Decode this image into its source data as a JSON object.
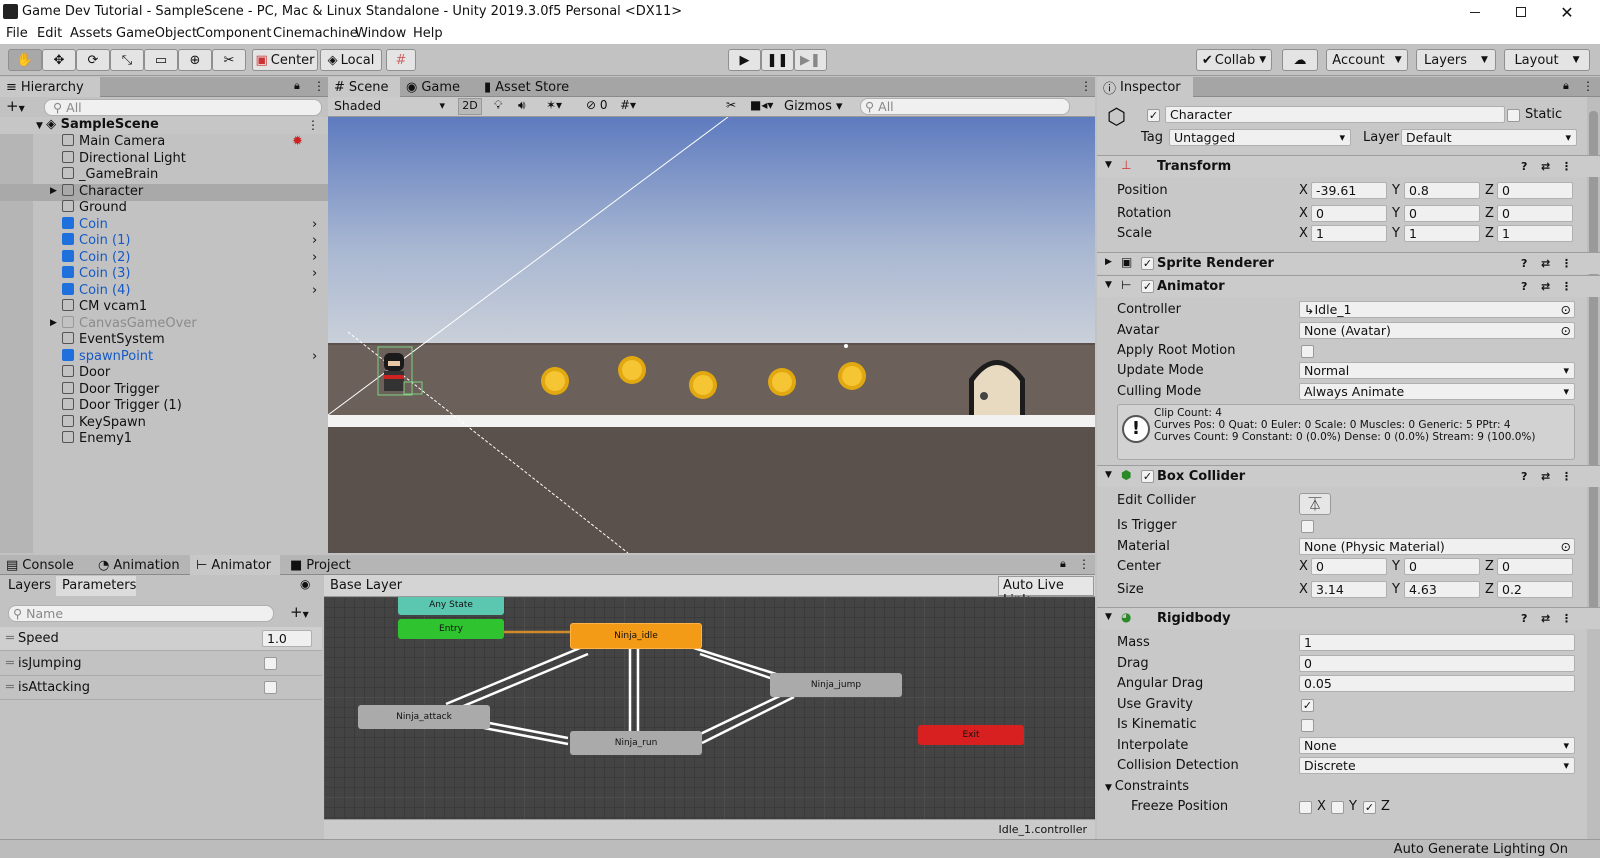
{
  "window": {
    "title": "Game Dev Tutorial - SampleScene - PC, Mac & Linux Standalone - Unity 2019.3.0f5 Personal <DX11>"
  },
  "menu": [
    "File",
    "Edit",
    "Assets",
    "GameObject",
    "Component",
    "Cinemachine",
    "Window",
    "Help"
  ],
  "toolbar": {
    "pivot": "Center",
    "space": "Local",
    "collab": "Collab",
    "account": "Account",
    "layers": "Layers",
    "layout": "Layout"
  },
  "hierarchy": {
    "tab": "Hierarchy",
    "search_placeholder": "All",
    "scene": "SampleScene",
    "items": [
      {
        "name": "Main Camera",
        "style": "normal"
      },
      {
        "name": "Directional Light",
        "style": "normal"
      },
      {
        "name": "_GameBrain",
        "style": "normal"
      },
      {
        "name": "Character",
        "style": "selected"
      },
      {
        "name": "Ground",
        "style": "normal"
      },
      {
        "name": "Coin",
        "style": "prefab"
      },
      {
        "name": "Coin (1)",
        "style": "prefab"
      },
      {
        "name": "Coin (2)",
        "style": "prefab"
      },
      {
        "name": "Coin (3)",
        "style": "prefab"
      },
      {
        "name": "Coin (4)",
        "style": "prefab"
      },
      {
        "name": "CM vcam1",
        "style": "normal"
      },
      {
        "name": "CanvasGameOver",
        "style": "disabled"
      },
      {
        "name": "EventSystem",
        "style": "normal"
      },
      {
        "name": "spawnPoint",
        "style": "prefab"
      },
      {
        "name": "Door",
        "style": "normal"
      },
      {
        "name": "Door Trigger",
        "style": "normal"
      },
      {
        "name": "Door Trigger (1)",
        "style": "normal"
      },
      {
        "name": "KeySpawn",
        "style": "normal"
      },
      {
        "name": "Enemy1",
        "style": "normal"
      }
    ]
  },
  "scene": {
    "tabs": [
      "Scene",
      "Game",
      "Asset Store"
    ],
    "shading": "Shaded",
    "mode2d": "2D",
    "hidden_count": "0",
    "gizmos": "Gizmos",
    "search_placeholder": "All"
  },
  "bottom": {
    "tabs": [
      "Console",
      "Animation",
      "Animator",
      "Project"
    ],
    "left_tabs": [
      "Layers",
      "Parameters"
    ],
    "name_placeholder": "Name",
    "params": [
      {
        "name": "Speed",
        "value": "1.0",
        "type": "float"
      },
      {
        "name": "isJumping",
        "value": false,
        "type": "bool"
      },
      {
        "name": "isAttacking",
        "value": false,
        "type": "bool"
      }
    ],
    "layer": "Base Layer",
    "live_link": "Auto Live Link",
    "states": {
      "any": "Any State",
      "entry": "Entry",
      "idle": "Ninja_idle",
      "attack": "Ninja_attack",
      "jump": "Ninja_jump",
      "run": "Ninja_run",
      "exit": "Exit"
    },
    "controller_file": "Idle_1.controller"
  },
  "inspector": {
    "tab": "Inspector",
    "object_name": "Character",
    "static": "Static",
    "tag_label": "Tag",
    "tag": "Untagged",
    "layer_label": "Layer",
    "layer": "Default",
    "transform": {
      "title": "Transform",
      "position": {
        "label": "Position",
        "x": "-39.61",
        "y": "0.8",
        "z": "0"
      },
      "rotation": {
        "label": "Rotation",
        "x": "0",
        "y": "0",
        "z": "0"
      },
      "scale": {
        "label": "Scale",
        "x": "1",
        "y": "1",
        "z": "1"
      }
    },
    "sprite_renderer": {
      "title": "Sprite Renderer"
    },
    "animator": {
      "title": "Animator",
      "controller_label": "Controller",
      "controller": "Idle_1",
      "avatar_label": "Avatar",
      "avatar": "None (Avatar)",
      "root_motion_label": "Apply Root Motion",
      "update_label": "Update Mode",
      "update": "Normal",
      "culling_label": "Culling Mode",
      "culling": "Always Animate",
      "info1": "Clip Count: 4",
      "info2": "Curves Pos: 0 Quat: 0 Euler: 0 Scale: 0 Muscles: 0 Generic: 5 PPtr: 4",
      "info3": "Curves Count: 9 Constant: 0 (0.0%) Dense: 0 (0.0%) Stream: 9 (100.0%)"
    },
    "box_collider": {
      "title": "Box Collider",
      "edit_label": "Edit Collider",
      "trigger_label": "Is Trigger",
      "material_label": "Material",
      "material": "None (Physic Material)",
      "center_label": "Center",
      "center": {
        "x": "0",
        "y": "0",
        "z": "0"
      },
      "size_label": "Size",
      "size": {
        "x": "3.14",
        "y": "4.63",
        "z": "0.2"
      }
    },
    "rigidbody": {
      "title": "Rigidbody",
      "mass_label": "Mass",
      "mass": "1",
      "drag_label": "Drag",
      "drag": "0",
      "angular_label": "Angular Drag",
      "angular": "0.05",
      "gravity_label": "Use Gravity",
      "kinematic_label": "Is Kinematic",
      "interpolate_label": "Interpolate",
      "interpolate": "None",
      "collision_label": "Collision Detection",
      "collision": "Discrete",
      "constraints_label": "Constraints",
      "freeze_label": "Freeze Position"
    }
  },
  "status": {
    "text": "Auto Generate Lighting On"
  },
  "axis": {
    "x": "X",
    "y": "Y",
    "z": "Z"
  },
  "colors": {
    "accent": "#1f6fdc",
    "idle_node": "#f39a17",
    "entry_node": "#2fc32f",
    "any_node": "#5cc7b0",
    "exit_node": "#d82020"
  }
}
